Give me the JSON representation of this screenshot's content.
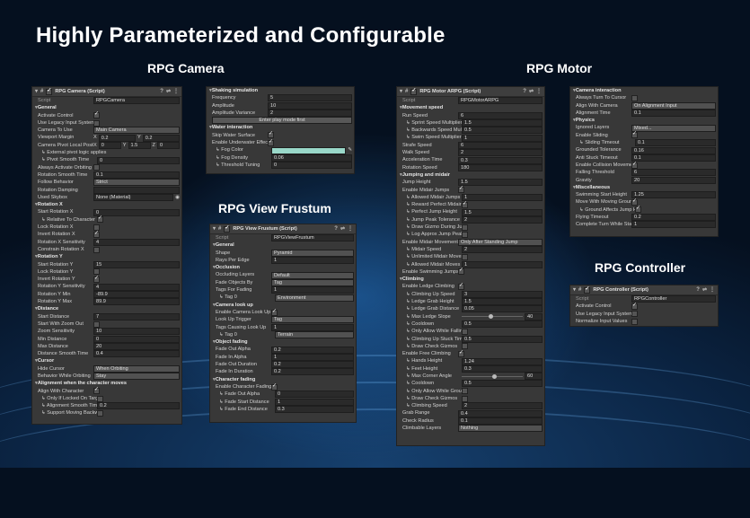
{
  "headline": "Highly Parameterized and Configurable",
  "sections": {
    "camera": "RPG Camera",
    "motor": "RPG Motor",
    "frustum": "RPG View Frustum",
    "controller": "RPG Controller"
  },
  "camera_panel": {
    "title": "RPG Camera (Script)",
    "script_label": "Script",
    "script_value": "RPGCamera",
    "rows": [
      {
        "t": "h",
        "l": "General"
      },
      {
        "t": "c",
        "l": "Activate Control",
        "v": true
      },
      {
        "t": "c",
        "l": "Use Legacy Input System",
        "v": false
      },
      {
        "t": "d",
        "l": "Camera To Use",
        "v": "Main Camera"
      },
      {
        "t": "xy",
        "l": "Viewport Margin",
        "a": "0.2",
        "b": "0.2"
      },
      {
        "t": "xyz",
        "l": "Camera Pivot Local Position",
        "a": "0",
        "b": "1.5",
        "c": "0"
      },
      {
        "t": "s",
        "l": "↳ External pivot logic applies",
        "ind": true
      },
      {
        "t": "f",
        "l": "↳ Pivot Smooth Time",
        "v": "0",
        "ind": true
      },
      {
        "t": "c",
        "l": "Always Activate Orbiting",
        "v": false
      },
      {
        "t": "f",
        "l": "Rotation Smooth Time",
        "v": "0.1"
      },
      {
        "t": "d",
        "l": "Follow Behavior",
        "v": "Strict"
      },
      {
        "t": "f",
        "l": "Rotation Damping",
        "v": ""
      },
      {
        "t": "o",
        "l": "Used Skybox",
        "v": "None (Material)"
      },
      {
        "t": "h",
        "l": "Rotation X"
      },
      {
        "t": "f",
        "l": "Start Rotation X",
        "v": "0"
      },
      {
        "t": "c",
        "l": "↳ Relative To Character",
        "v": true,
        "ind": true
      },
      {
        "t": "c",
        "l": "Lock Rotation X",
        "v": false
      },
      {
        "t": "c",
        "l": "Invert Rotation X",
        "v": true
      },
      {
        "t": "f",
        "l": "Rotation X Sensitivity",
        "v": "4"
      },
      {
        "t": "c",
        "l": "Constrain Rotation X",
        "v": false
      },
      {
        "t": "h",
        "l": "Rotation Y"
      },
      {
        "t": "f",
        "l": "Start Rotation Y",
        "v": "15"
      },
      {
        "t": "c",
        "l": "Lock Rotation Y",
        "v": false
      },
      {
        "t": "c",
        "l": "Invert Rotation Y",
        "v": true
      },
      {
        "t": "f",
        "l": "Rotation Y Sensitivity",
        "v": "4"
      },
      {
        "t": "f",
        "l": "Rotation Y Min",
        "v": "-89.9"
      },
      {
        "t": "f",
        "l": "Rotation Y Max",
        "v": "89.9"
      },
      {
        "t": "h",
        "l": "Distance"
      },
      {
        "t": "f",
        "l": "Start Distance",
        "v": "7"
      },
      {
        "t": "c",
        "l": "Start With Zoom Out",
        "v": false
      },
      {
        "t": "f",
        "l": "Zoom Sensitivity",
        "v": "10"
      },
      {
        "t": "f",
        "l": "Min Distance",
        "v": "0"
      },
      {
        "t": "f",
        "l": "Max Distance",
        "v": "20"
      },
      {
        "t": "f",
        "l": "Distance Smooth Time",
        "v": "0.4"
      },
      {
        "t": "h",
        "l": "Cursor"
      },
      {
        "t": "d",
        "l": "Hide Cursor",
        "v": "When Orbiting"
      },
      {
        "t": "d",
        "l": "Behavior While Orbiting",
        "v": "Stay"
      },
      {
        "t": "h",
        "l": "Alignment when the character moves"
      },
      {
        "t": "c",
        "l": "Align With Character",
        "v": true
      },
      {
        "t": "c",
        "l": "↳ Only If Locked On Target",
        "v": false,
        "ind": true
      },
      {
        "t": "f",
        "l": "↳ Alignment Smooth Time",
        "v": "0.2",
        "ind": true
      },
      {
        "t": "c",
        "l": "↳ Support Moving Backwards",
        "v": false,
        "ind": true
      }
    ]
  },
  "water_panel": {
    "rows": [
      {
        "t": "h",
        "l": "Shaking simulation"
      },
      {
        "t": "f",
        "l": "Frequency",
        "v": "5"
      },
      {
        "t": "f",
        "l": "Amplitude",
        "v": "10"
      },
      {
        "t": "f",
        "l": "Amplitude Variance",
        "v": "2"
      },
      {
        "t": "b",
        "v": "Enter play mode first"
      },
      {
        "t": "h",
        "l": "Water interaction"
      },
      {
        "t": "c",
        "l": "Skip Water Surface",
        "v": true
      },
      {
        "t": "c",
        "l": "Enable Underwater Effect",
        "v": true
      },
      {
        "t": "col",
        "l": "↳ Fog Color",
        "ind": true
      },
      {
        "t": "f",
        "l": "↳ Fog Density",
        "v": "0.06",
        "ind": true
      },
      {
        "t": "f",
        "l": "↳ Threshold Tuning",
        "v": "0",
        "ind": true
      }
    ]
  },
  "frustum_panel": {
    "title": "RPG View Frustum (Script)",
    "script_label": "Script",
    "script_value": "RPGViewFrustum",
    "rows": [
      {
        "t": "h",
        "l": "General"
      },
      {
        "t": "d",
        "l": "Shape",
        "v": "Pyramid"
      },
      {
        "t": "f",
        "l": "Rays Per Edge",
        "v": "1"
      },
      {
        "t": "h",
        "l": "Occlusion"
      },
      {
        "t": "d",
        "l": "Occluding Layers",
        "v": "Default"
      },
      {
        "t": "d",
        "l": "Fade Objects By",
        "v": "Tag"
      },
      {
        "t": "f",
        "l": "Tags For Fading",
        "v": "1"
      },
      {
        "t": "d",
        "l": "↳ Tag 0",
        "v": "Environment",
        "ind": true
      },
      {
        "t": "h",
        "l": "Camera look up"
      },
      {
        "t": "c",
        "l": "Enable Camera Look Up",
        "v": true
      },
      {
        "t": "d",
        "l": "Look Up Trigger",
        "v": "Tag"
      },
      {
        "t": "f",
        "l": "Tags Causing Look Up",
        "v": "1"
      },
      {
        "t": "d",
        "l": "↳ Tag 0",
        "v": "Terrain",
        "ind": true
      },
      {
        "t": "h",
        "l": "Object fading"
      },
      {
        "t": "f",
        "l": "Fade Out Alpha",
        "v": "0.2"
      },
      {
        "t": "f",
        "l": "Fade In Alpha",
        "v": "1"
      },
      {
        "t": "f",
        "l": "Fade Out Duration",
        "v": "0.2"
      },
      {
        "t": "f",
        "l": "Fade In Duration",
        "v": "0.2"
      },
      {
        "t": "h",
        "l": "Character fading"
      },
      {
        "t": "c",
        "l": "Enable Character Fading",
        "v": true
      },
      {
        "t": "f",
        "l": "↳ Fade Out Alpha",
        "v": "0",
        "ind": true
      },
      {
        "t": "f",
        "l": "↳ Fade Start Distance",
        "v": "1",
        "ind": true
      },
      {
        "t": "f",
        "l": "↳ Fade End Distance",
        "v": "0.3",
        "ind": true
      }
    ]
  },
  "motor_panel": {
    "title": "RPG Motor ARPG (Script)",
    "script_label": "Script",
    "script_value": "RPGMotorARPG",
    "rows": [
      {
        "t": "h",
        "l": "Movement speed"
      },
      {
        "t": "f",
        "l": "Run Speed",
        "v": "6"
      },
      {
        "t": "f",
        "l": "↳ Sprint Speed Multiplier",
        "v": "1.5",
        "ind": true
      },
      {
        "t": "f",
        "l": "↳ Backwards Speed Multiplier",
        "v": "0.5",
        "ind": true
      },
      {
        "t": "f",
        "l": "↳ Swim Speed Multiplier",
        "v": "1",
        "ind": true
      },
      {
        "t": "f",
        "l": "Strafe Speed",
        "v": "6"
      },
      {
        "t": "f",
        "l": "Walk Speed",
        "v": "2"
      },
      {
        "t": "f",
        "l": "Acceleration Time",
        "v": "0.3"
      },
      {
        "t": "f",
        "l": "Rotation Speed",
        "v": "180"
      },
      {
        "t": "h",
        "l": "Jumping and midair"
      },
      {
        "t": "f",
        "l": "Jump Height",
        "v": "1.5"
      },
      {
        "t": "c",
        "l": "Enable Midair Jumps",
        "v": true
      },
      {
        "t": "f",
        "l": "↳ Allowed Midair Jumps",
        "v": "1",
        "ind": true
      },
      {
        "t": "c",
        "l": "↳ Reward Perfect Midair Jumps",
        "v": true,
        "ind": true
      },
      {
        "t": "f",
        "l": "↳ Perfect Jump Height",
        "v": "1.5",
        "ind": true
      },
      {
        "t": "f",
        "l": "↳ Jump Peak Tolerance",
        "v": "2",
        "ind": true
      },
      {
        "t": "c",
        "l": "↳ Draw Gizmo During Jump",
        "v": false,
        "ind": true
      },
      {
        "t": "c",
        "l": "↳ Log Approx Jump Peak",
        "v": false,
        "ind": true
      },
      {
        "t": "d",
        "l": "Enable Midair Movement",
        "v": "Only After Standing Jump"
      },
      {
        "t": "f",
        "l": "↳ Midair Speed",
        "v": "2",
        "ind": true
      },
      {
        "t": "c",
        "l": "↳ Unlimited Midair Moves",
        "v": false,
        "ind": true
      },
      {
        "t": "f",
        "l": "↳ Allowed Midair Moves",
        "v": "1",
        "ind": true
      },
      {
        "t": "c",
        "l": "Enable Swimming Jumps",
        "v": true
      },
      {
        "t": "h",
        "l": "Climbing"
      },
      {
        "t": "c",
        "l": "Enable Ledge Climbing",
        "v": true
      },
      {
        "t": "f",
        "l": "↳ Climbing Up Speed",
        "v": "3",
        "ind": true
      },
      {
        "t": "f",
        "l": "↳ Ledge Grab Height",
        "v": "1.5",
        "ind": true
      },
      {
        "t": "f",
        "l": "↳ Ledge Grab Distance",
        "v": "0.05",
        "ind": true
      },
      {
        "t": "sl",
        "l": "↳ Max Ledge Slope",
        "v": "40",
        "p": 0.44,
        "ind": true
      },
      {
        "t": "f",
        "l": "↳ Cooldown",
        "v": "0.5",
        "ind": true
      },
      {
        "t": "c",
        "l": "↳ Only Allow While Falling",
        "v": false,
        "ind": true
      },
      {
        "t": "f",
        "l": "↳ Climbing Up Stuck Timeout",
        "v": "0.5",
        "ind": true
      },
      {
        "t": "c",
        "l": "↳ Draw Check Gizmos",
        "v": false,
        "ind": true
      },
      {
        "t": "c",
        "l": "Enable Free Climbing",
        "v": true
      },
      {
        "t": "f",
        "l": "↳ Hands Height",
        "v": "1.24",
        "ind": true
      },
      {
        "t": "f",
        "l": "↳ Feet Height",
        "v": "0.3",
        "ind": true
      },
      {
        "t": "sl",
        "l": "↳ Max Corner Angle",
        "v": "60",
        "p": 0.5,
        "ind": true
      },
      {
        "t": "f",
        "l": "↳ Cooldown",
        "v": "0.5",
        "ind": true
      },
      {
        "t": "c",
        "l": "↳ Only Allow While Grounded",
        "v": false,
        "ind": true
      },
      {
        "t": "c",
        "l": "↳ Draw Check Gizmos",
        "v": false,
        "ind": true
      },
      {
        "t": "f",
        "l": "↳ Climbing Speed",
        "v": "2",
        "ind": true
      },
      {
        "t": "f",
        "l": "Grab Range",
        "v": "0.4"
      },
      {
        "t": "f",
        "l": "Check Radius",
        "v": "0.1"
      },
      {
        "t": "d",
        "l": "Climbable Layers",
        "v": "Nothing"
      }
    ]
  },
  "motor_panel2": {
    "rows": [
      {
        "t": "h",
        "l": "Camera interaction"
      },
      {
        "t": "c",
        "l": "Always Turn To Cursor",
        "v": false
      },
      {
        "t": "d",
        "l": "Align With Camera",
        "v": "On Alignment Input"
      },
      {
        "t": "f",
        "l": "Alignment Time",
        "v": "0.1"
      },
      {
        "t": "h",
        "l": "Physics"
      },
      {
        "t": "d",
        "l": "Ignored Layers",
        "v": "Mixed..."
      },
      {
        "t": "c",
        "l": "Enable Sliding",
        "v": true
      },
      {
        "t": "f",
        "l": "↳ Sliding Timeout",
        "v": "0.1",
        "ind": true
      },
      {
        "t": "f",
        "l": "Grounded Tolerance",
        "v": "0.16"
      },
      {
        "t": "f",
        "l": "Anti Stuck Timeout",
        "v": "0.1"
      },
      {
        "t": "c",
        "l": "Enable Collision Movement",
        "v": true
      },
      {
        "t": "f",
        "l": "Falling Threshold",
        "v": "6"
      },
      {
        "t": "f",
        "l": "Gravity",
        "v": "20"
      },
      {
        "t": "h",
        "l": "Miscellaneous"
      },
      {
        "t": "f",
        "l": "Swimming Start Height",
        "v": "1.25"
      },
      {
        "t": "c",
        "l": "Move With Moving Ground",
        "v": true
      },
      {
        "t": "c",
        "l": "↳ Ground Affects Jump Height",
        "v": true,
        "ind": true
      },
      {
        "t": "f",
        "l": "Flying Timeout",
        "v": "0.2"
      },
      {
        "t": "f",
        "l": "Complete Turn While Standing",
        "v": "1"
      }
    ]
  },
  "controller_panel": {
    "title": "RPG Controller (Script)",
    "script_label": "Script",
    "script_value": "RPGController",
    "rows": [
      {
        "t": "c",
        "l": "Activate Control",
        "v": true
      },
      {
        "t": "c",
        "l": "Use Legacy Input System",
        "v": false
      },
      {
        "t": "c",
        "l": "Normalize Input Values",
        "v": false
      }
    ]
  },
  "colors": {
    "fog_color": "#9ad8c9",
    "panel_bg": "#383838"
  }
}
